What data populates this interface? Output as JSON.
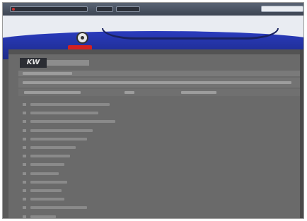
{
  "browser": {
    "address_icon": "favicon-icon",
    "toolbar_buttons": [
      "back-button",
      "forward-button"
    ]
  },
  "site": {
    "logo_label": "",
    "nav_items": [
      "",
      "",
      "",
      "",
      "",
      "",
      "",
      ""
    ]
  },
  "content": {
    "brand_mark": "KW",
    "links": [
      {
        "width": 0.28
      },
      {
        "width": 0.24
      },
      {
        "width": 0.3
      },
      {
        "width": 0.22
      },
      {
        "width": 0.2
      },
      {
        "width": 0.16
      },
      {
        "width": 0.14
      },
      {
        "width": 0.12
      },
      {
        "width": 0.1
      },
      {
        "width": 0.13
      },
      {
        "width": 0.11
      },
      {
        "width": 0.12
      },
      {
        "width": 0.2
      },
      {
        "width": 0.09
      }
    ]
  },
  "colors": {
    "header_blue": "#2a3bbd",
    "logo_red": "#d42020",
    "page_gray": "#6a6a6a"
  }
}
